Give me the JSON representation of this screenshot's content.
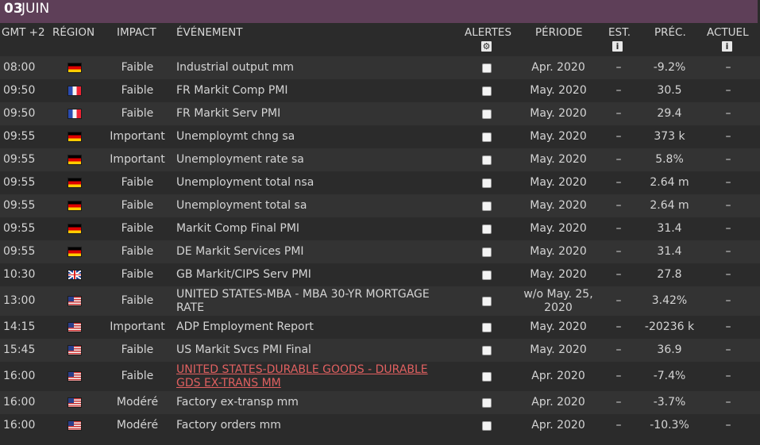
{
  "date_bar": {
    "day": "03",
    "month": "JUIN"
  },
  "columns": {
    "time": "GMT +2",
    "region": "RÉGION",
    "impact": "IMPACT",
    "event": "ÉVÉNEMENT",
    "alerts": "ALERTES",
    "period": "PÉRIODE",
    "est": "EST.",
    "prec": "PRÉC.",
    "actual": "ACTUEL",
    "alerts_icon": "gear-icon",
    "est_icon": "info-icon",
    "actual_icon": "info-icon",
    "info_glyph": "i",
    "gear_glyph": "⚙"
  },
  "rows": [
    {
      "time": "08:00",
      "flag": "de",
      "impact": "Faible",
      "event": "Industrial output mm",
      "period": "Apr. 2020",
      "est": "–",
      "prec": "-9.2%",
      "actual": "–"
    },
    {
      "time": "09:50",
      "flag": "fr",
      "impact": "Faible",
      "event": "FR Markit Comp PMI",
      "period": "May. 2020",
      "est": "–",
      "prec": "30.5",
      "actual": "–"
    },
    {
      "time": "09:50",
      "flag": "fr",
      "impact": "Faible",
      "event": "FR Markit Serv PMI",
      "period": "May. 2020",
      "est": "–",
      "prec": "29.4",
      "actual": "–"
    },
    {
      "time": "09:55",
      "flag": "de",
      "impact": "Important",
      "event": "Unemploymt chng sa",
      "period": "May. 2020",
      "est": "–",
      "prec": "373 k",
      "actual": "–"
    },
    {
      "time": "09:55",
      "flag": "de",
      "impact": "Important",
      "event": "Unemployment rate sa",
      "period": "May. 2020",
      "est": "–",
      "prec": "5.8%",
      "actual": "–"
    },
    {
      "time": "09:55",
      "flag": "de",
      "impact": "Faible",
      "event": "Unemployment total nsa",
      "period": "May. 2020",
      "est": "–",
      "prec": "2.64 m",
      "actual": "–"
    },
    {
      "time": "09:55",
      "flag": "de",
      "impact": "Faible",
      "event": "Unemployment total sa",
      "period": "May. 2020",
      "est": "–",
      "prec": "2.64 m",
      "actual": "–"
    },
    {
      "time": "09:55",
      "flag": "de",
      "impact": "Faible",
      "event": "Markit Comp Final PMI",
      "period": "May. 2020",
      "est": "–",
      "prec": "31.4",
      "actual": "–"
    },
    {
      "time": "09:55",
      "flag": "de",
      "impact": "Faible",
      "event": "DE Markit Services PMI",
      "period": "May. 2020",
      "est": "–",
      "prec": "31.4",
      "actual": "–"
    },
    {
      "time": "10:30",
      "flag": "gb",
      "impact": "Faible",
      "event": "GB Markit/CIPS Serv PMI",
      "period": "May. 2020",
      "est": "–",
      "prec": "27.8",
      "actual": "–"
    },
    {
      "time": "13:00",
      "flag": "us",
      "impact": "Faible",
      "event": "UNITED STATES-MBA - MBA 30-YR MORTGAGE RATE",
      "period": "w/o May. 25, 2020",
      "est": "–",
      "prec": "3.42%",
      "actual": "–"
    },
    {
      "time": "14:15",
      "flag": "us",
      "impact": "Important",
      "event": "ADP Employment Report",
      "period": "May. 2020",
      "est": "–",
      "prec": "-20236 k",
      "actual": "–"
    },
    {
      "time": "15:45",
      "flag": "us",
      "impact": "Faible",
      "event": "US Markit Svcs PMI Final",
      "period": "May. 2020",
      "est": "–",
      "prec": "36.9",
      "actual": "–"
    },
    {
      "time": "16:00",
      "flag": "us",
      "impact": "Faible",
      "event": "UNITED STATES-DURABLE GOODS - DURABLE GDS EX-TRANS MM",
      "period": "Apr. 2020",
      "est": "–",
      "prec": "-7.4%",
      "actual": "–",
      "link": true
    },
    {
      "time": "16:00",
      "flag": "us",
      "impact": "Modéré",
      "event": "Factory ex-transp mm",
      "period": "Apr. 2020",
      "est": "–",
      "prec": "-3.7%",
      "actual": "–"
    },
    {
      "time": "16:00",
      "flag": "us",
      "impact": "Modéré",
      "event": "Factory orders mm",
      "period": "Apr. 2020",
      "est": "–",
      "prec": "-10.3%",
      "actual": "–"
    }
  ]
}
